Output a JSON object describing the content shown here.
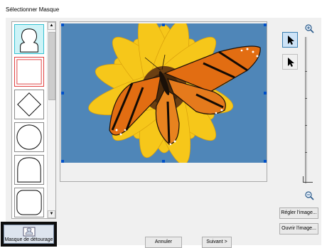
{
  "window": {
    "title": "Sélectionner Masque"
  },
  "mask_list": {
    "items": [
      {
        "shape": "head-silhouette",
        "selected": true
      },
      {
        "shape": "square",
        "selected": false
      },
      {
        "shape": "diamond",
        "selected": false
      },
      {
        "shape": "circle",
        "selected": false
      },
      {
        "shape": "arch",
        "selected": false
      },
      {
        "shape": "rounded-square",
        "selected": false
      }
    ]
  },
  "tools": {
    "select_arrow": "arrow-pointer-icon",
    "move_arrow": "pointer-icon"
  },
  "buttons": {
    "adjust_image": "Régler l'image...",
    "open_image": "Ouvrir l'image...",
    "cancel": "Annuler",
    "next": "Suivant >",
    "outline_mask": "Masque de détourage"
  },
  "colors": {
    "selection": "#cde3f7",
    "selection_border": "#3c7fb1",
    "handle": "#0050c8",
    "selected_mask_border": "#35c0d0",
    "second_mask_border": "#e04040"
  }
}
